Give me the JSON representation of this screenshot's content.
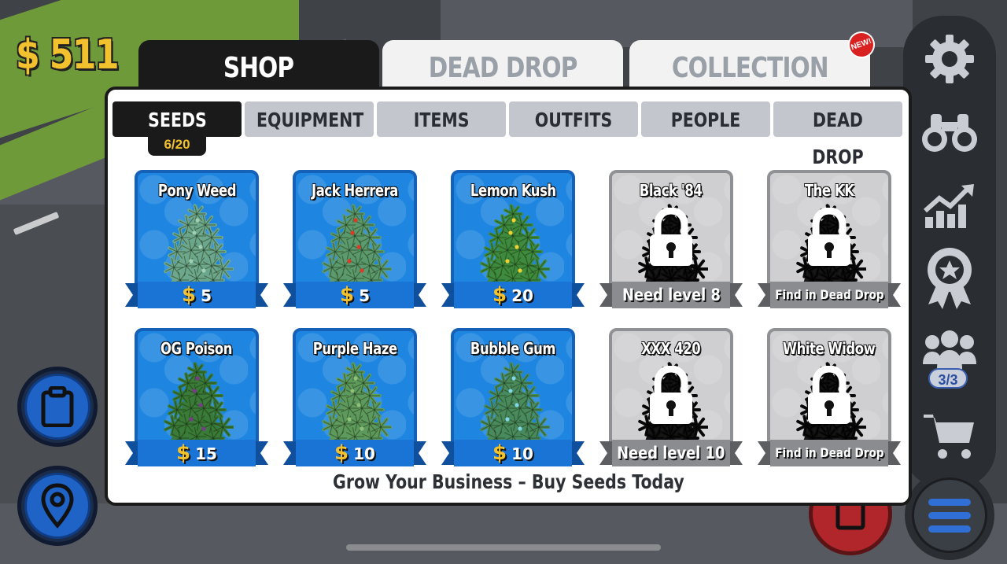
{
  "hud": {
    "money": "$ 511"
  },
  "top_tabs": [
    {
      "label": "SHOP",
      "active": true
    },
    {
      "label": "DEAD DROP",
      "active": false
    },
    {
      "label": "COLLECTION",
      "active": false,
      "badge": "NEW!"
    }
  ],
  "sub_tabs": [
    {
      "label": "SEEDS",
      "active": true
    },
    {
      "label": "EQUIPMENT",
      "active": false
    },
    {
      "label": "ITEMS",
      "active": false
    },
    {
      "label": "OUTFITS",
      "active": false
    },
    {
      "label": "PEOPLE",
      "active": false
    },
    {
      "label": "DEAD DROP",
      "active": false
    }
  ],
  "seed_count": "6/20",
  "seeds": [
    {
      "name": "Pony Weed",
      "price": "5",
      "locked": false,
      "plant_color": "#6fa88a",
      "bud_color": "#9fd0b5"
    },
    {
      "name": "Jack Herrera",
      "price": "5",
      "locked": false,
      "plant_color": "#5d9a6a",
      "bud_color": "#d93a2a"
    },
    {
      "name": "Lemon Kush",
      "price": "20",
      "locked": false,
      "plant_color": "#3f8a3a",
      "bud_color": "#f2d22e"
    },
    {
      "name": "Black '84",
      "locked": true,
      "requirement": "Need level 8"
    },
    {
      "name": "The KK",
      "locked": true,
      "requirement": "Find in Dead Drop"
    },
    {
      "name": "OG Poison",
      "price": "15",
      "locked": false,
      "plant_color": "#3a7a34",
      "bud_color": "#7a3a8a"
    },
    {
      "name": "Purple Haze",
      "price": "10",
      "locked": false,
      "plant_color": "#5f9a5a",
      "bud_color": "#8fc07a"
    },
    {
      "name": "Bubble Gum",
      "price": "10",
      "locked": false,
      "plant_color": "#4a8a5a",
      "bud_color": "#7fd6e6"
    },
    {
      "name": "XXX 420",
      "locked": true,
      "requirement": "Need level 10"
    },
    {
      "name": "White Widow",
      "locked": true,
      "requirement": "Find in Dead Drop"
    }
  ],
  "footer": "Grow Your Business – Buy Seeds Today",
  "sidebar": {
    "crew_count": "3/3",
    "icons": [
      "gear-icon",
      "binoculars-icon",
      "chart-icon",
      "award-icon",
      "people-icon",
      "cart-icon"
    ]
  },
  "colors": {
    "card_blue": "#1e86e0",
    "card_locked": "#cfcfd1",
    "money_gold": "#f2c12e",
    "ribbon_blue": "#1a74d6",
    "ribbon_gray": "#8a8c90"
  }
}
